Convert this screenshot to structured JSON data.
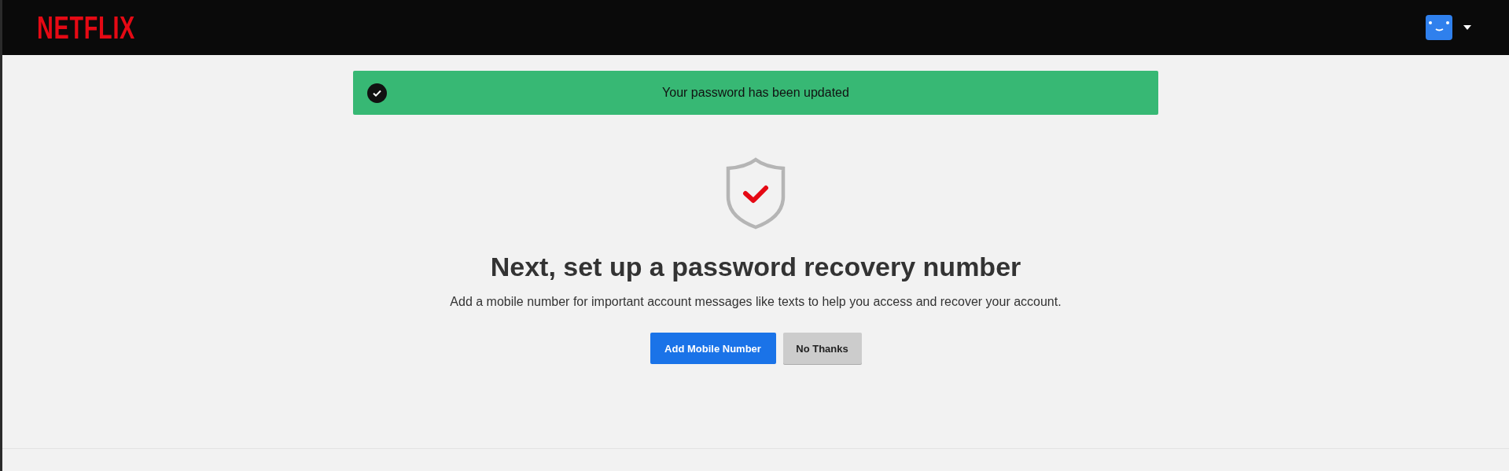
{
  "header": {
    "logo": "NETFLIX"
  },
  "banner": {
    "kind": "success",
    "message": "Your password has been updated"
  },
  "heading": "Next, set up a password recovery number",
  "description": "Add a mobile number for important account messages like texts to help you access and recover your account.",
  "buttons": [
    {
      "label": "Add Mobile Number",
      "kind": "primary"
    },
    {
      "label": "No Thanks",
      "kind": "secondary"
    }
  ]
}
